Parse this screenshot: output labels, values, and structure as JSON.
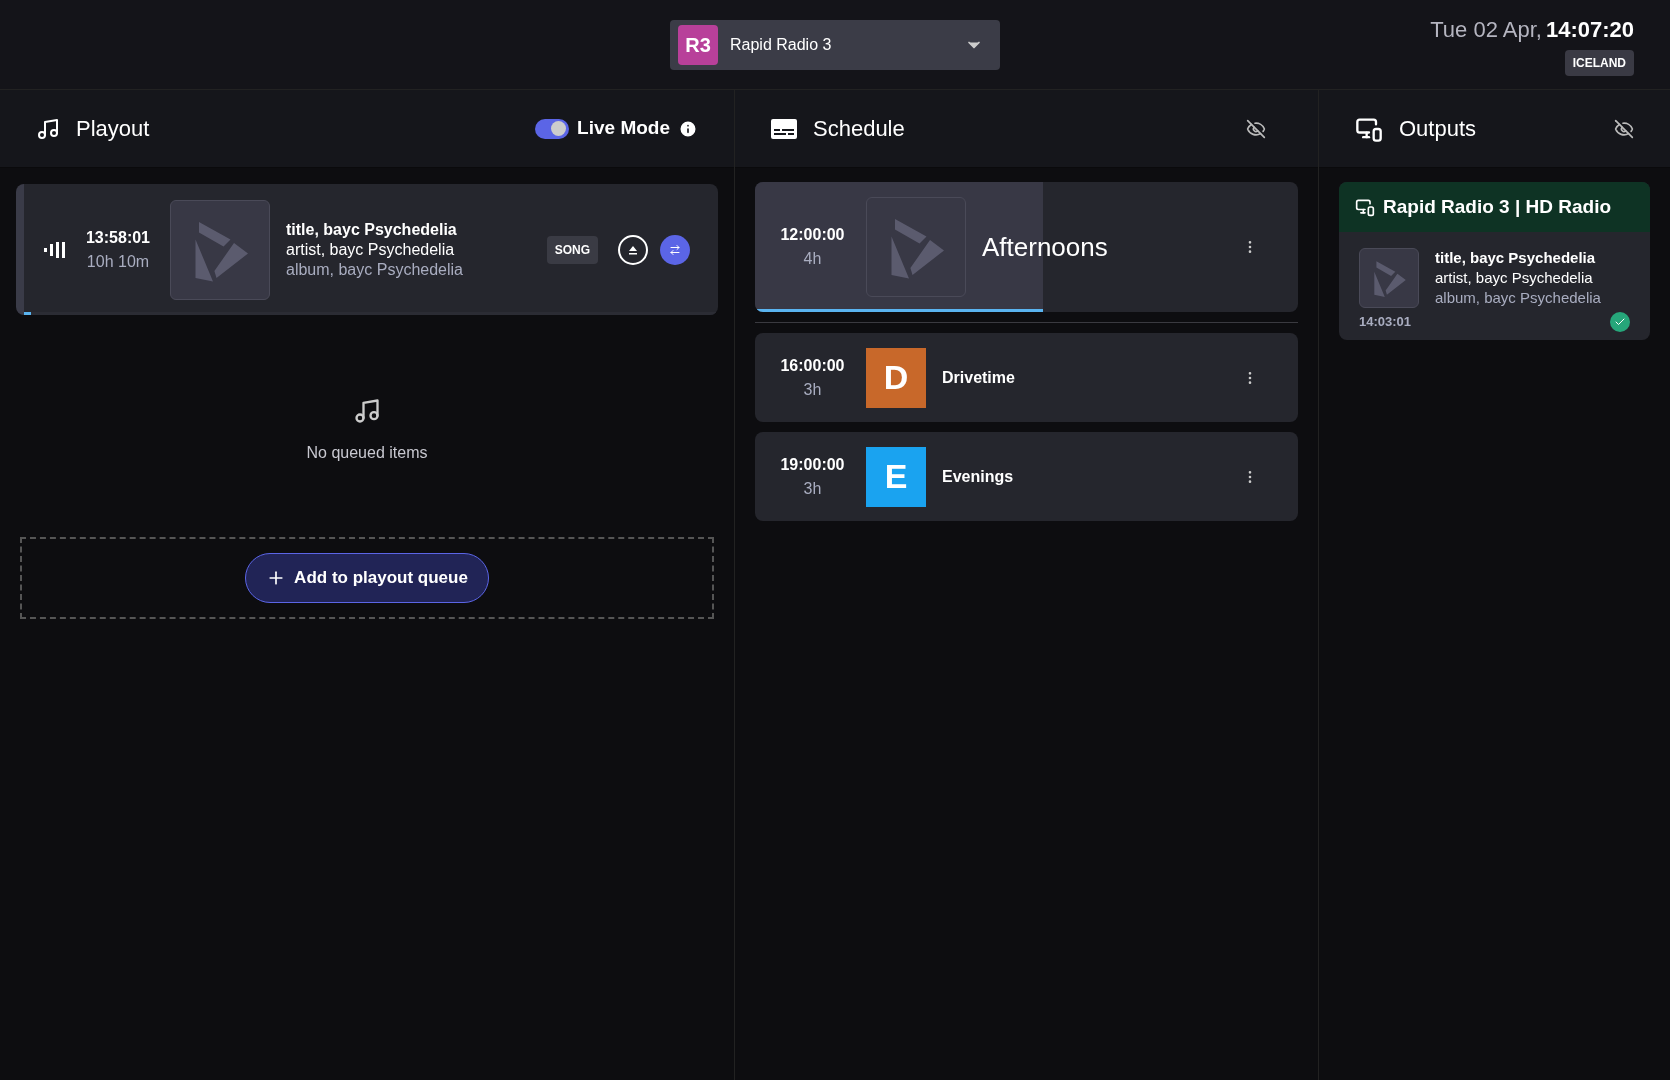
{
  "station": {
    "badge": "R3",
    "name": "Rapid Radio 3"
  },
  "clock": {
    "date": "Tue 02 Apr,",
    "time": "14:07:20",
    "zone": "ICELAND"
  },
  "playout": {
    "title": "Playout",
    "live_mode": {
      "label": "Live Mode",
      "on": true
    },
    "now_playing": {
      "time": "13:58:01",
      "duration": "10h 10m",
      "title": "title, bayc Psychedelia",
      "artist": "artist, bayc Psychedelia",
      "album": "album, bayc Psychedelia",
      "tag": "SONG",
      "level": 0.01
    },
    "empty_text": "No queued items",
    "add_button": "Add to playout queue"
  },
  "schedule": {
    "title": "Schedule",
    "items": [
      {
        "kind": "logo",
        "time": "12:00:00",
        "duration": "4h",
        "name": "Afternoons",
        "current": true,
        "level": 0.53
      },
      {
        "kind": "letter",
        "letter": "D",
        "color": "#c8682a",
        "time": "16:00:00",
        "duration": "3h",
        "name": "Drivetime",
        "current": false
      },
      {
        "kind": "letter",
        "letter": "E",
        "color": "#1aa3f0",
        "time": "19:00:00",
        "duration": "3h",
        "name": "Evenings",
        "current": false
      }
    ]
  },
  "outputs": {
    "title": "Outputs",
    "items": [
      {
        "name": "Rapid Radio 3 | HD Radio",
        "title": "title, bayc Psychedelia",
        "artist": "artist, bayc Psychedelia",
        "album": "album, bayc Psychedelia",
        "time": "14:03:01",
        "ok": true
      }
    ]
  }
}
